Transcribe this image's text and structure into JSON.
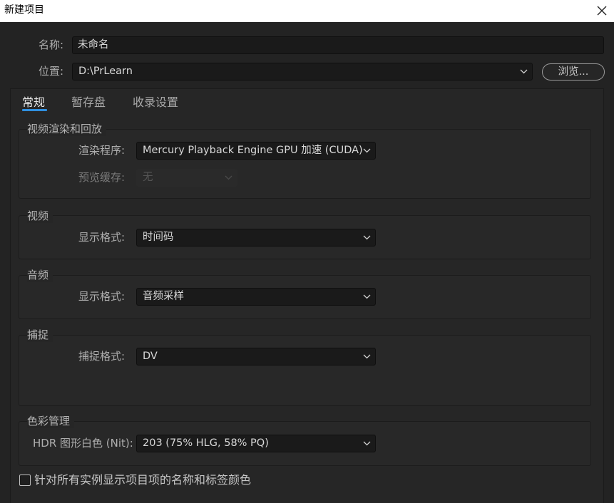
{
  "window": {
    "title": "新建项目",
    "close_icon": "close-icon"
  },
  "project": {
    "name_label": "名称:",
    "name_value": "未命名",
    "location_label": "位置:",
    "location_value": "D:\\PrLearn",
    "browse_label": "浏览..."
  },
  "tabs": [
    {
      "label": "常规",
      "active": true
    },
    {
      "label": "暂存盘",
      "active": false
    },
    {
      "label": "收录设置",
      "active": false
    }
  ],
  "video_render": {
    "title": "视频渲染和回放",
    "renderer_label": "渲染程序:",
    "renderer_value": "Mercury Playback Engine GPU 加速 (CUDA)",
    "preview_cache_label": "预览缓存:",
    "preview_cache_value": "无"
  },
  "video": {
    "title": "视频",
    "format_label": "显示格式:",
    "format_value": "时间码"
  },
  "audio": {
    "title": "音频",
    "format_label": "显示格式:",
    "format_value": "音频采样"
  },
  "capture": {
    "title": "捕捉",
    "format_label": "捕捉格式:",
    "format_value": "DV"
  },
  "color": {
    "title": "色彩管理",
    "hdr_label": "HDR 图形白色 (Nit):",
    "hdr_value": "203 (75% HLG, 58% PQ)"
  },
  "options": {
    "show_label_colors": "针对所有实例显示项目项的名称和标签颜色",
    "show_label_colors_checked": false
  },
  "colors": {
    "accent": "#2f8fe0",
    "background": "#232323",
    "field": "#1a1a1a"
  }
}
